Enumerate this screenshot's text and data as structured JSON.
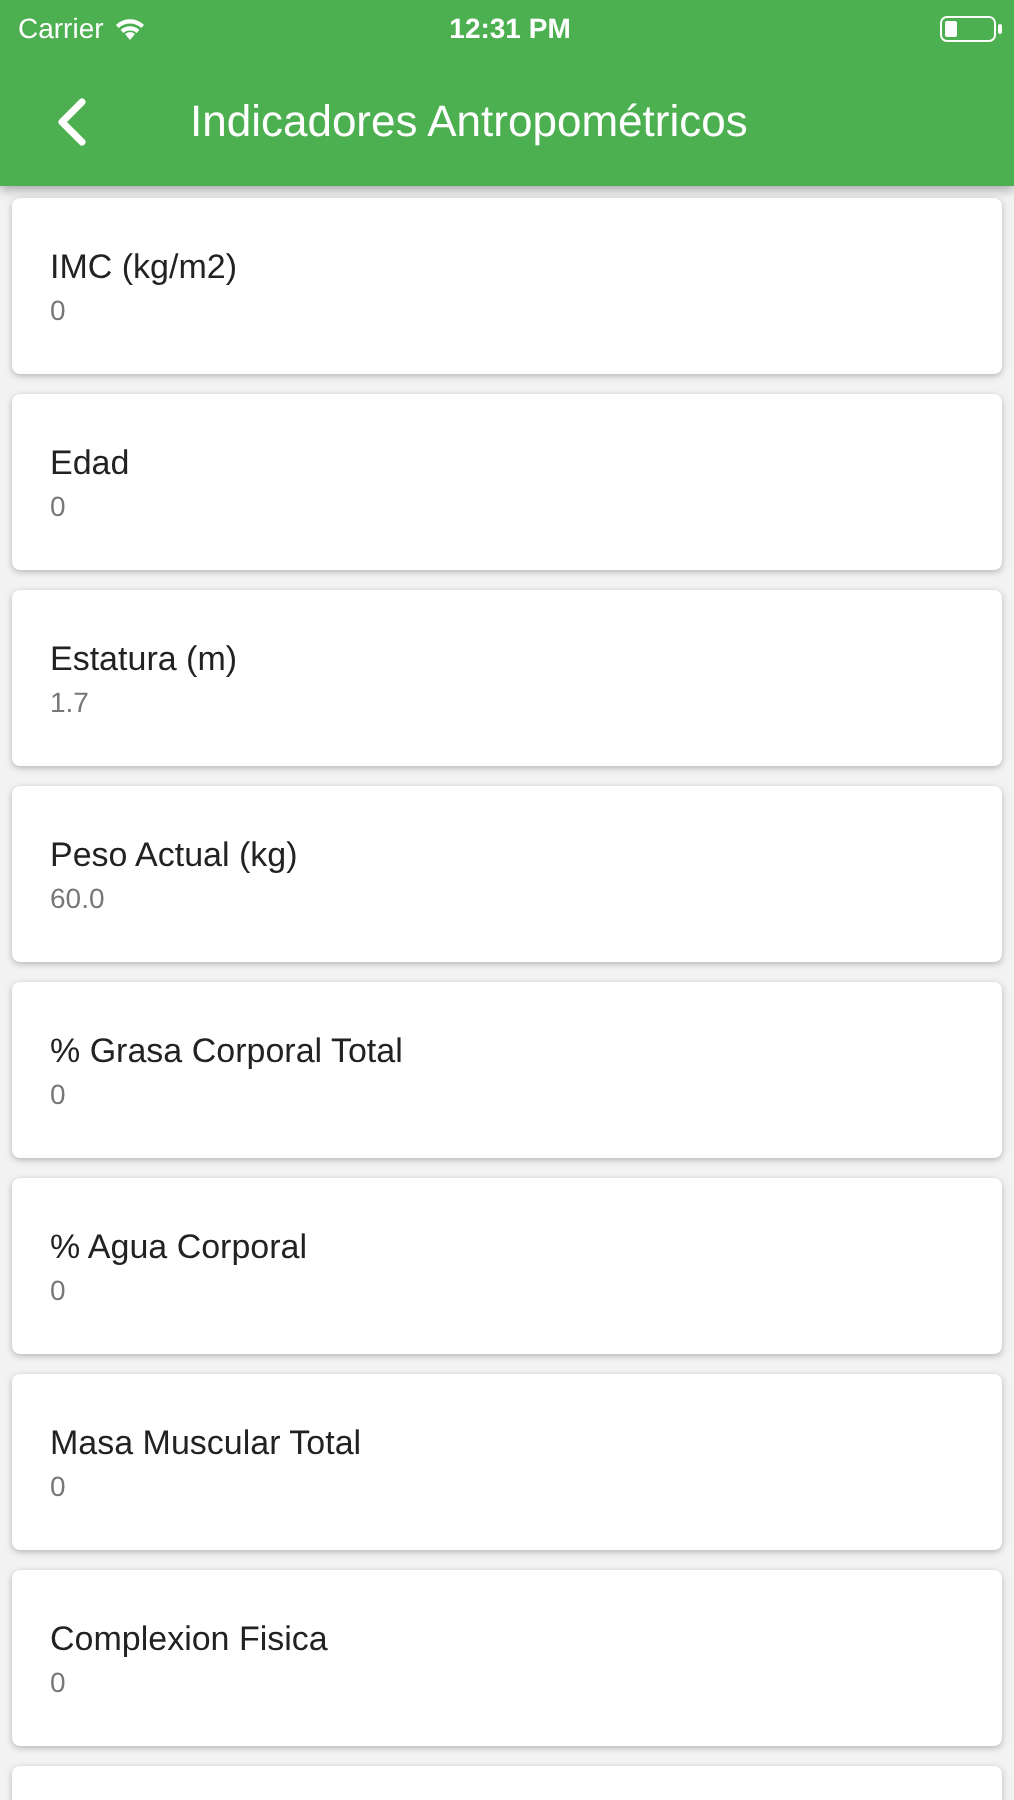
{
  "status_bar": {
    "carrier": "Carrier",
    "time": "12:31 PM"
  },
  "header": {
    "title": "Indicadores Antropométricos"
  },
  "items": [
    {
      "label": "IMC (kg/m2)",
      "value": "0"
    },
    {
      "label": "Edad",
      "value": "0"
    },
    {
      "label": "Estatura (m)",
      "value": "1.7"
    },
    {
      "label": "Peso Actual (kg)",
      "value": "60.0"
    },
    {
      "label": "% Grasa Corporal Total",
      "value": "0"
    },
    {
      "label": "% Agua Corporal",
      "value": "0"
    },
    {
      "label": "Masa Muscular Total",
      "value": "0"
    },
    {
      "label": "Complexion Fisica",
      "value": "0"
    }
  ]
}
